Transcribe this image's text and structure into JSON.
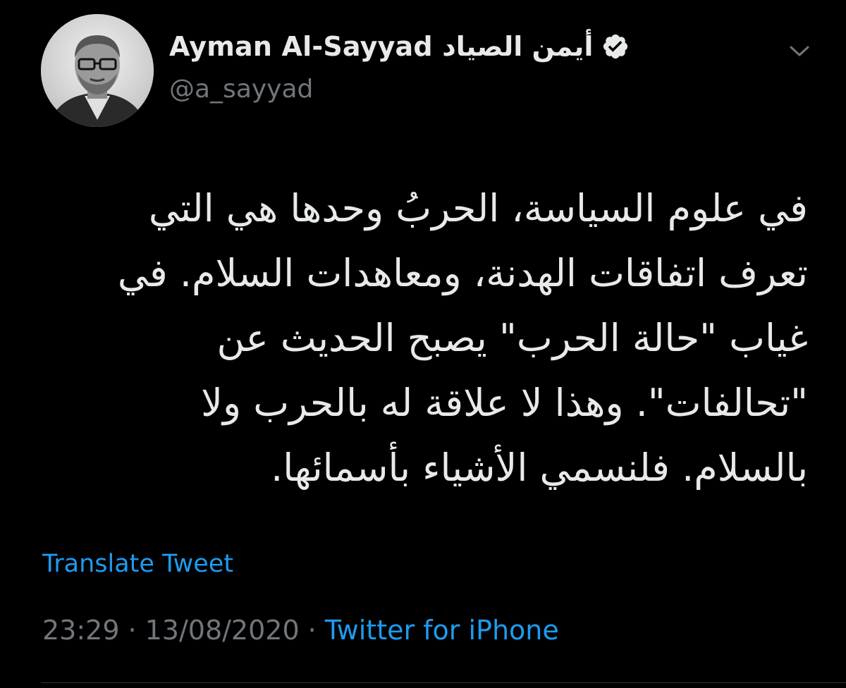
{
  "author": {
    "display_name": "Ayman Al-Sayyad أيمن الصياد",
    "handle": "@a_sayyad",
    "verified_icon": "verified-badge-icon",
    "avatar_alt": "profile photo"
  },
  "menu": {
    "icon": "chevron-down-icon"
  },
  "tweet": {
    "lines": [
      "في علوم السياسة، الحربُ وحدها هي التي",
      "تعرف اتفاقات الهدنة، ومعاهدات السلام. في",
      "غياب \"حالة الحرب\" يصبح الحديث عن",
      "\"تحالفات\". وهذا لا علاقة له بالحرب ولا",
      "بالسلام. فلنسمي الأشياء بأسمائها."
    ]
  },
  "translate": {
    "label": "Translate Tweet"
  },
  "meta": {
    "time": "23:29",
    "date": "13/08/2020",
    "separator": "·",
    "source": "Twitter for iPhone"
  },
  "colors": {
    "background": "#000000",
    "primary_text": "#e7e9ea",
    "secondary_text": "#71767b",
    "link": "#1d9bf0"
  }
}
